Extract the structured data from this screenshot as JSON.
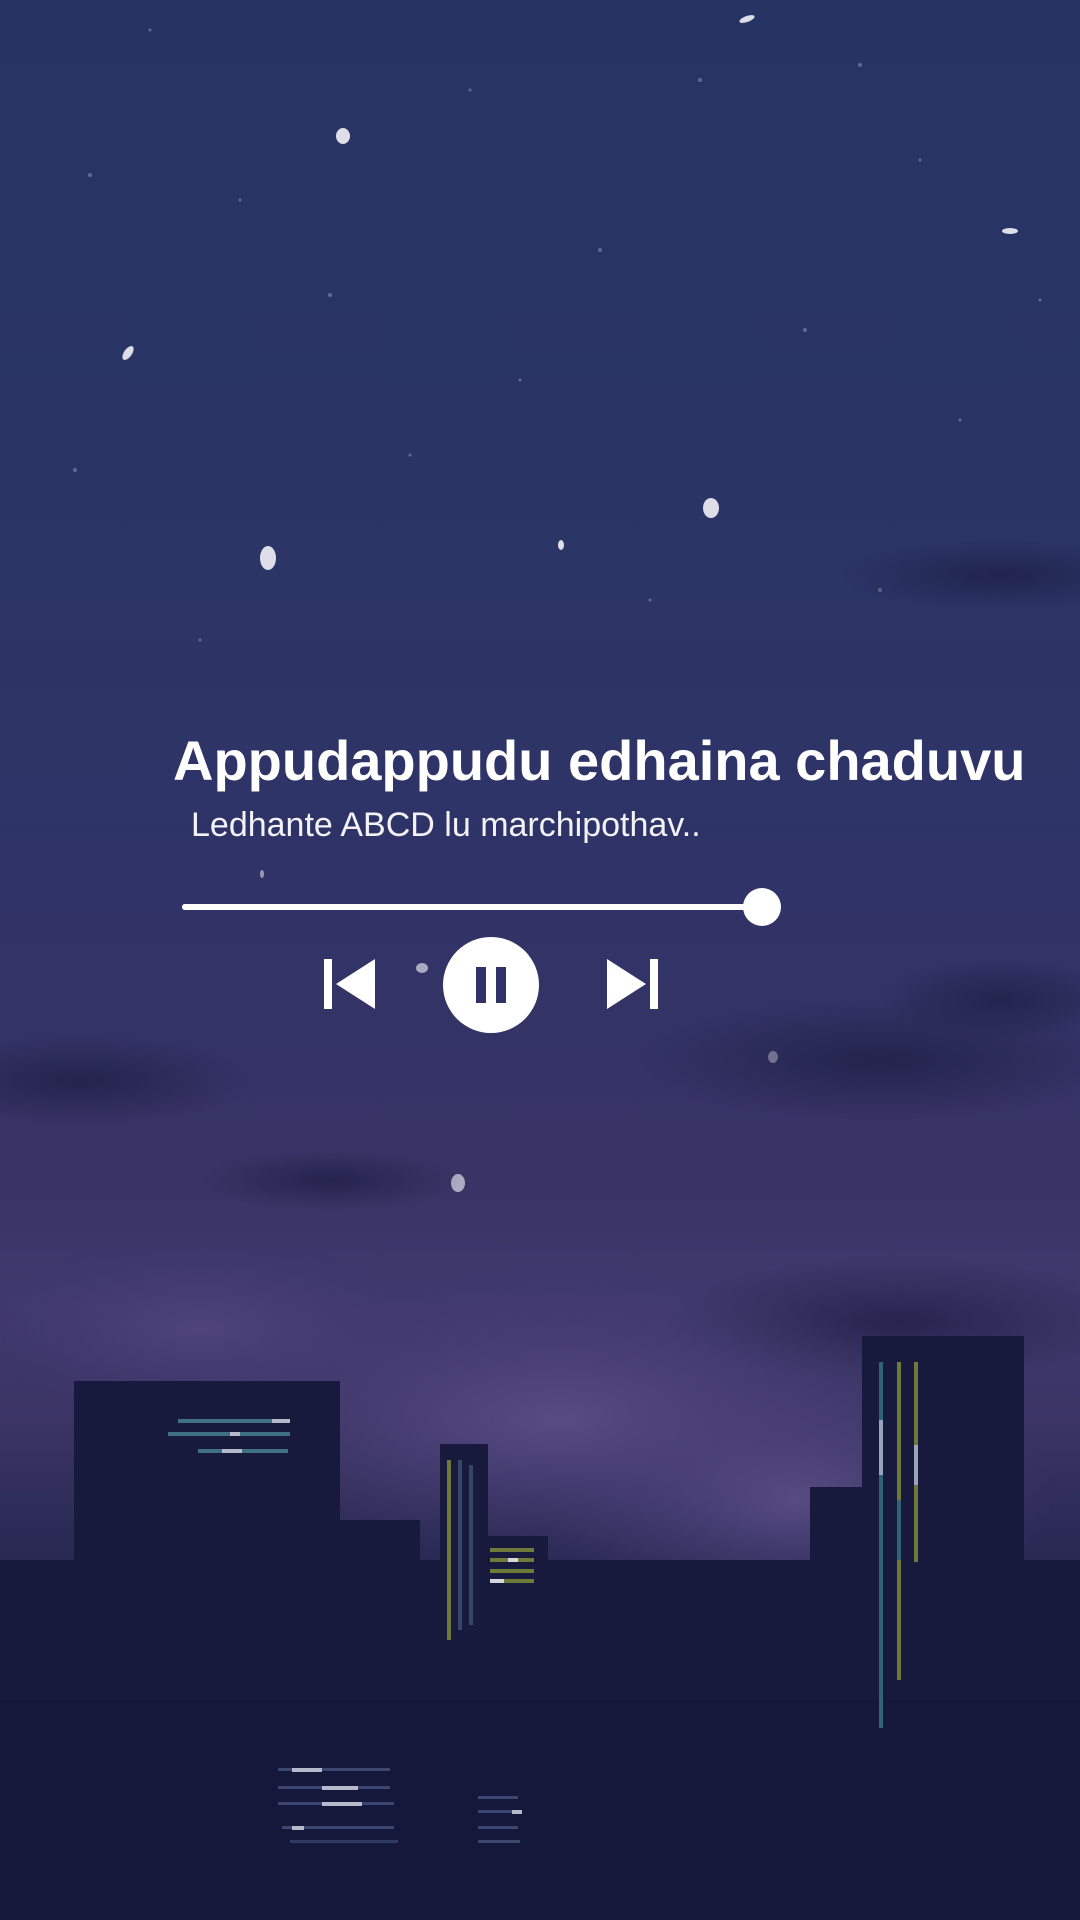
{
  "song": {
    "title": "Appudappudu edhaina chaduvu",
    "subtitle": "Ledhante ABCD lu marchipothav.."
  },
  "progress": {
    "fraction": 0.97
  },
  "controls": {
    "previous_icon": "skip-previous-icon",
    "play_pause_icon": "pause-icon",
    "next_icon": "skip-next-icon"
  },
  "colors": {
    "sky_top": "#263463",
    "sky_bottom": "#1c1b40",
    "foreground": "#ffffff",
    "buildings": "#181a3c"
  }
}
